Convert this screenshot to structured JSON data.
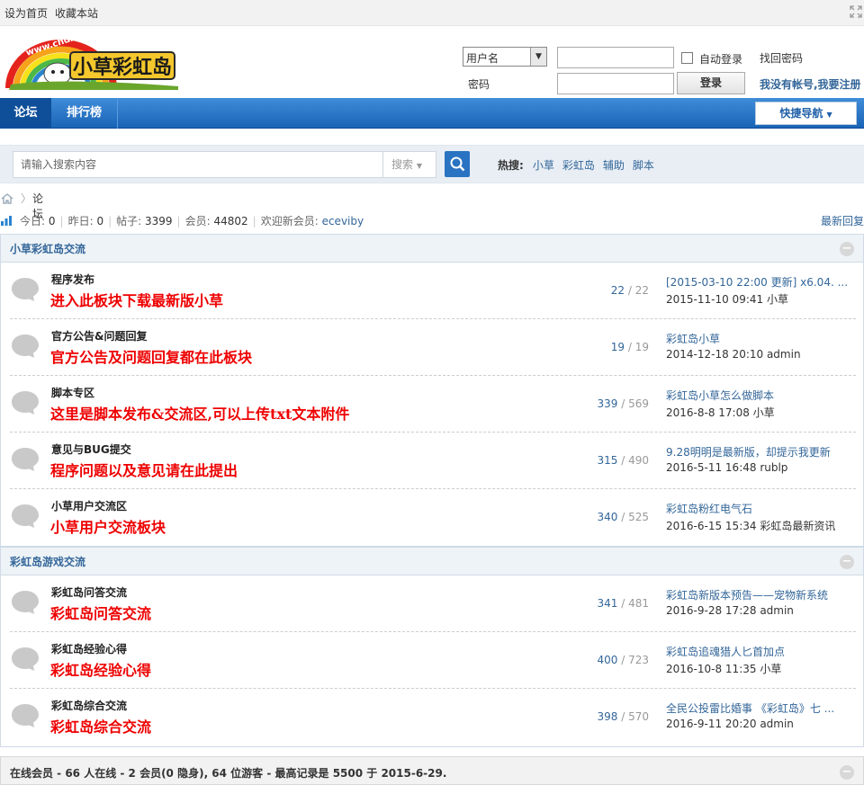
{
  "topbar": {
    "set_home": "设为首页",
    "bookmark": "收藏本站"
  },
  "logo": {
    "url_text": "www.chdxc.com",
    "name": "小草彩虹岛"
  },
  "login": {
    "username_select": "用户名",
    "password_label": "密码",
    "auto_login": "自动登录",
    "login_button": "登录",
    "forgot": "找回密码",
    "register": "我没有帐号,我要注册"
  },
  "nav": {
    "tab_forum": "论坛",
    "tab_rank": "排行榜",
    "quick_nav": "快捷导航"
  },
  "search": {
    "placeholder": "请输入搜索内容",
    "type": "搜索",
    "hot_label": "热搜:",
    "hot": [
      "小草",
      "彩虹岛",
      "辅助",
      "脚本"
    ]
  },
  "breadcrumb": {
    "current": "论坛"
  },
  "stats": {
    "today_label": "今日:",
    "today": "0",
    "yesterday_label": "昨日:",
    "yesterday": "0",
    "posts_label": "帖子:",
    "posts": "3399",
    "members_label": "会员:",
    "members": "44802",
    "welcome_label": "欢迎新会员:",
    "new_member": "eceviby",
    "latest_reply": "最新回复"
  },
  "categories": [
    {
      "name": "小草彩虹岛交流",
      "forums": [
        {
          "name": "程序发布",
          "desc": "进入此板块下载最新版小草",
          "threads": "22",
          "posts": "22",
          "last_title": "[2015-03-10 22:00 更新] x6.04. ...",
          "last_info": "2015-11-10 09:41 小草"
        },
        {
          "name": "官方公告&问题回复",
          "desc": "官方公告及问题回复都在此板块",
          "threads": "19",
          "posts": "19",
          "last_title": "彩虹岛小草",
          "last_info": "2014-12-18 20:10 admin"
        },
        {
          "name": "脚本专区",
          "desc": "这里是脚本发布&交流区,可以上传txt文本附件",
          "threads": "339",
          "posts": "569",
          "last_title": "彩虹岛小草怎么做脚本",
          "last_info": "2016-8-8 17:08 小草"
        },
        {
          "name": "意见与BUG提交",
          "desc": "程序问题以及意见请在此提出",
          "threads": "315",
          "posts": "490",
          "last_title": "9.28明明是最新版，却提示我更新",
          "last_info": "2016-5-11 16:48 rublp"
        },
        {
          "name": "小草用户交流区",
          "desc": "小草用户交流板块",
          "threads": "340",
          "posts": "525",
          "last_title": "彩虹岛粉红电气石",
          "last_info": "2016-6-15 15:34 彩虹岛最新资讯"
        }
      ]
    },
    {
      "name": "彩虹岛游戏交流",
      "forums": [
        {
          "name": "彩虹岛问答交流",
          "desc": "彩虹岛问答交流",
          "threads": "341",
          "posts": "481",
          "last_title": "彩虹岛新版本预告——宠物新系统",
          "last_info": "2016-9-28 17:28 admin"
        },
        {
          "name": "彩虹岛经验心得",
          "desc": "彩虹岛经验心得",
          "threads": "400",
          "posts": "723",
          "last_title": "彩虹岛追魂猎人匕首加点",
          "last_info": "2016-10-8 11:35 小草"
        },
        {
          "name": "彩虹岛综合交流",
          "desc": "彩虹岛综合交流",
          "threads": "398",
          "posts": "570",
          "last_title": "全民公投雷比婚事 《彩虹岛》七 ...",
          "last_info": "2016-9-11 20:20 admin"
        }
      ]
    }
  ],
  "online": {
    "text": "在线会员 - 66 人在线 - 2 会员(0 隐身), 64 位游客 - 最高记录是 5500 于 2015-6-29."
  },
  "colors": {
    "accent": "#1a64b6",
    "link": "#336699",
    "desc_red": "#ee0000",
    "category_bg": "#eef3f7"
  }
}
